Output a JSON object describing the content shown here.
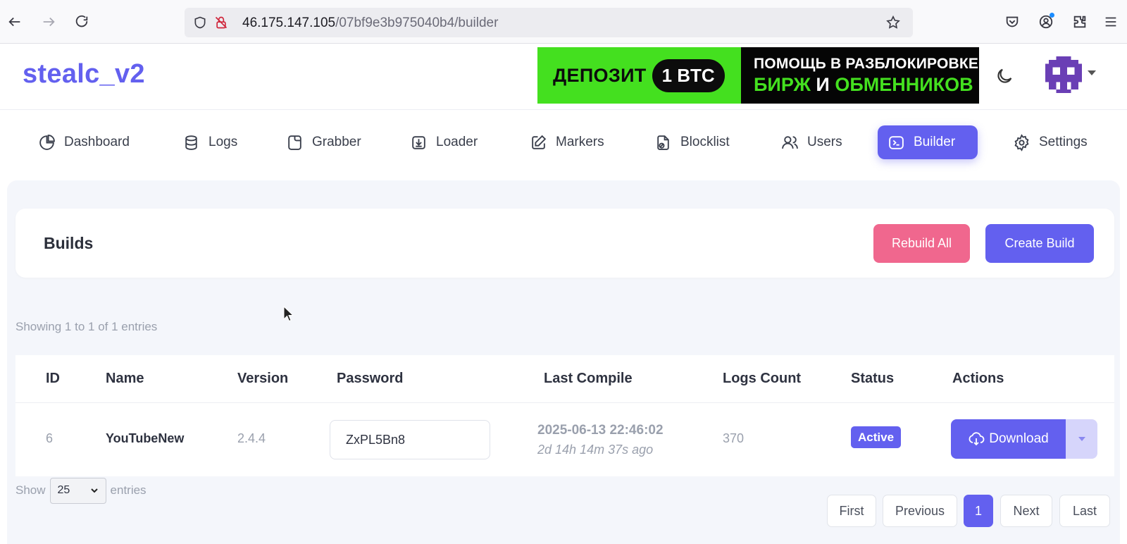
{
  "browser": {
    "url_host": "46.175.147.105",
    "url_path": "/07bf9e3b975040b4/builder"
  },
  "header": {
    "brand": "stealc_v2",
    "banner": {
      "left_word": "ДЕПОЗИТ",
      "left_pill": "1 BTC",
      "line1": "ПОМОЩЬ В РАЗБЛОКИРОВКЕ",
      "line2_a": "БИРЖ",
      "line2_b": "И",
      "line2_c": "ОБМЕННИКОВ",
      "colors": {
        "green": "#44e01f",
        "black": "#050505"
      }
    }
  },
  "nav": {
    "items": [
      {
        "label": "Dashboard",
        "icon": "pie-chart-icon"
      },
      {
        "label": "Logs",
        "icon": "database-icon"
      },
      {
        "label": "Grabber",
        "icon": "folder-icon"
      },
      {
        "label": "Loader",
        "icon": "download-box-icon"
      },
      {
        "label": "Markers",
        "icon": "edit-icon"
      },
      {
        "label": "Blocklist",
        "icon": "file-blocked-icon"
      },
      {
        "label": "Users",
        "icon": "users-icon"
      },
      {
        "label": "Builder",
        "icon": "terminal-icon"
      },
      {
        "label": "Settings",
        "icon": "gear-icon"
      }
    ],
    "active": "Builder"
  },
  "builds": {
    "title": "Builds",
    "rebuild_label": "Rebuild All",
    "create_label": "Create Build"
  },
  "table": {
    "showing_text": "Showing 1 to 1 of 1 entries",
    "columns": [
      "ID",
      "Name",
      "Version",
      "Password",
      "Last Compile",
      "Logs Count",
      "Status",
      "Actions"
    ],
    "rows": [
      {
        "id": "6",
        "name": "YouTubeNew",
        "version": "2.4.4",
        "password": "ZxPL5Bn8",
        "last_compile": "2025-06-13 22:46:02",
        "compile_ago": "2d 14h 14m 37s ago",
        "logs_count": "370",
        "status": "Active",
        "action_label": "Download"
      }
    ]
  },
  "footer": {
    "show_label": "Show",
    "page_size": "25",
    "entries_label": "entries",
    "pagination": {
      "first": "First",
      "previous": "Previous",
      "current": "1",
      "next": "Next",
      "last": "Last"
    }
  },
  "colors": {
    "accent": "#6360ef",
    "danger": "#f0678e",
    "muted": "#9aa0ad"
  }
}
